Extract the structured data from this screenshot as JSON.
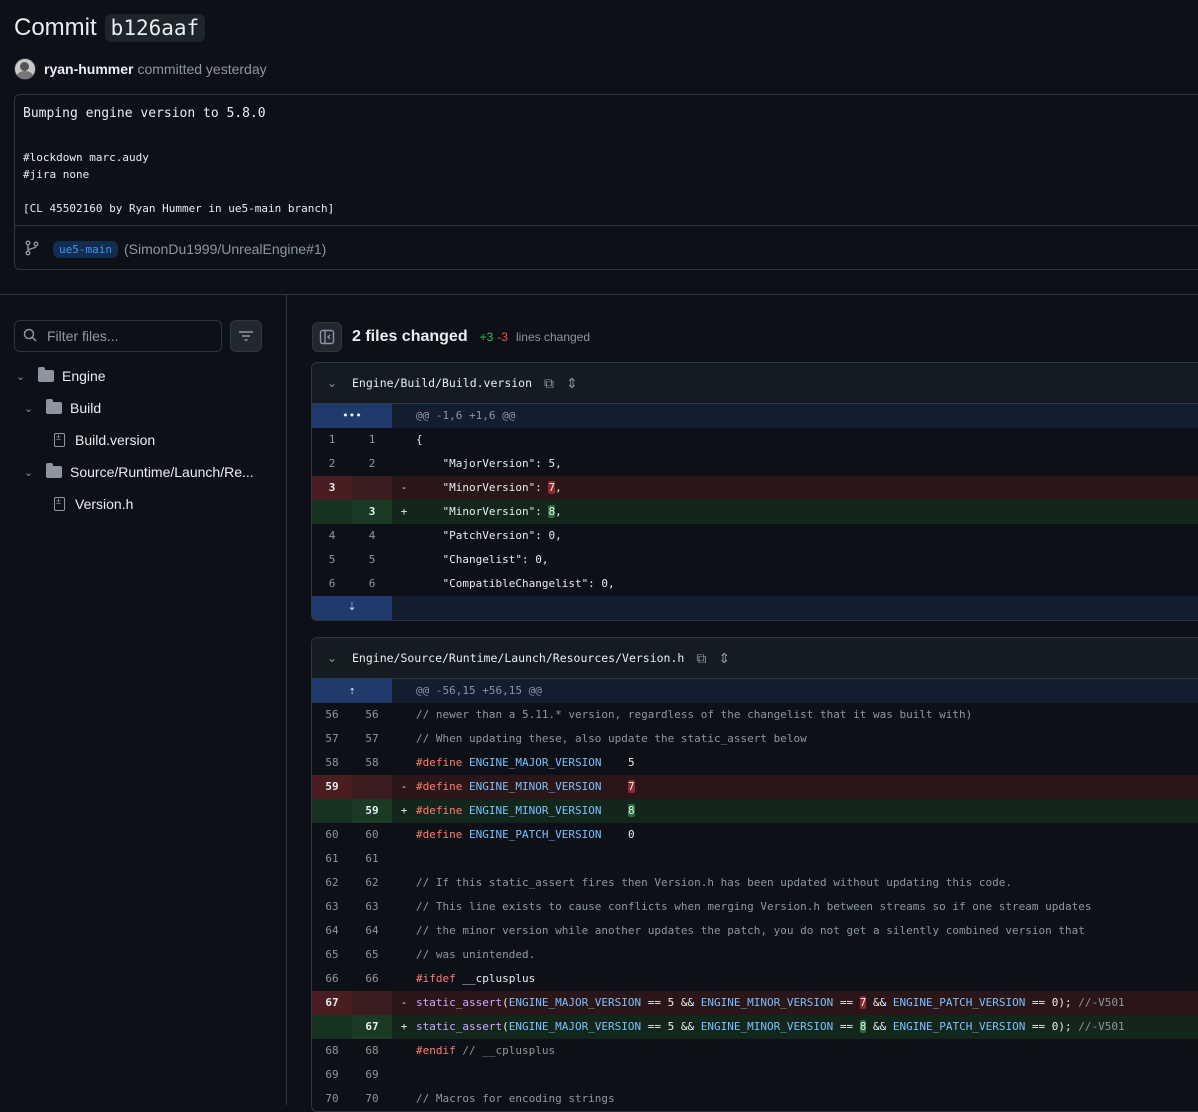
{
  "commit": {
    "title_prefix": "Commit",
    "sha": "b126aaf",
    "author": "ryan-hummer",
    "committed_text": "committed yesterday",
    "message_lines": [
      "Bumping engine version to 5.8.0",
      "",
      "#lockdown marc.audy",
      "#jira none",
      "",
      "[CL 45502160 by Ryan Hummer in ue5-main branch]"
    ],
    "branch": "ue5-main",
    "pr_ref": "(SimonDu1999/UnrealEngine#1)"
  },
  "sidebar": {
    "filter_placeholder": "Filter files...",
    "tree": [
      {
        "label": "Engine",
        "type": "folder",
        "depth": 0
      },
      {
        "label": "Build",
        "type": "folder",
        "depth": 1
      },
      {
        "label": "Build.version",
        "type": "file",
        "depth": 2
      },
      {
        "label": "Source/Runtime/Launch/Re...",
        "type": "folder",
        "depth": 1
      },
      {
        "label": "Version.h",
        "type": "file",
        "depth": 2
      }
    ]
  },
  "summary": {
    "files_changed": "2 files changed",
    "additions": "+3",
    "deletions": "-3",
    "lines_changed": "lines changed"
  },
  "files": [
    {
      "path": "Engine/Build/Build.version",
      "hunk": "@@ -1,6 +1,6 @@",
      "lines": [
        {
          "old": "1",
          "new": "1",
          "type": "ctx",
          "code": "{"
        },
        {
          "old": "2",
          "new": "2",
          "type": "ctx",
          "code": "    \"MajorVersion\": 5,"
        },
        {
          "old": "3",
          "new": "",
          "type": "del",
          "pre": "    \"MinorVersion\": ",
          "hl": "7",
          "post": ","
        },
        {
          "old": "",
          "new": "3",
          "type": "add",
          "pre": "    \"MinorVersion\": ",
          "hl": "8",
          "post": ","
        },
        {
          "old": "4",
          "new": "4",
          "type": "ctx",
          "code": "    \"PatchVersion\": 0,"
        },
        {
          "old": "5",
          "new": "5",
          "type": "ctx",
          "code": "    \"Changelist\": 0,"
        },
        {
          "old": "6",
          "new": "6",
          "type": "ctx",
          "code": "    \"CompatibleChangelist\": 0,"
        }
      ]
    },
    {
      "path": "Engine/Source/Runtime/Launch/Resources/Version.h",
      "hunk": "@@ -56,15 +56,15 @@",
      "lines": [
        {
          "old": "56",
          "new": "56",
          "type": "ctx",
          "code": "// newer than a 5.11.* version, regardless of the changelist that it was built with)",
          "style": "cm"
        },
        {
          "old": "57",
          "new": "57",
          "type": "ctx",
          "code": "// When updating these, also update the static_assert below",
          "style": "cm"
        },
        {
          "old": "58",
          "new": "58",
          "type": "ctx",
          "define": "ENGINE_MAJOR_VERSION",
          "val": "5"
        },
        {
          "old": "59",
          "new": "",
          "type": "del",
          "define": "ENGINE_MINOR_VERSION",
          "hl": "7"
        },
        {
          "old": "",
          "new": "59",
          "type": "add",
          "define": "ENGINE_MINOR_VERSION",
          "hl": "8"
        },
        {
          "old": "60",
          "new": "60",
          "type": "ctx",
          "define": "ENGINE_PATCH_VERSION",
          "val": "0"
        },
        {
          "old": "61",
          "new": "61",
          "type": "ctx",
          "code": ""
        },
        {
          "old": "62",
          "new": "62",
          "type": "ctx",
          "code": "// If this static_assert fires then Version.h has been updated without updating this code.",
          "style": "cm"
        },
        {
          "old": "63",
          "new": "63",
          "type": "ctx",
          "code": "// This line exists to cause conflicts when merging Version.h between streams so if one stream updates",
          "style": "cm"
        },
        {
          "old": "64",
          "new": "64",
          "type": "ctx",
          "code": "// the minor version while another updates the patch, you do not get a silently combined version that",
          "style": "cm"
        },
        {
          "old": "65",
          "new": "65",
          "type": "ctx",
          "code": "// was unintended.",
          "style": "cm"
        },
        {
          "old": "66",
          "new": "66",
          "type": "ctx",
          "ifdef": "#ifdef",
          "rest": " __cplusplus"
        },
        {
          "old": "67",
          "new": "",
          "type": "del",
          "assert": true,
          "hl": "7"
        },
        {
          "old": "",
          "new": "67",
          "type": "add",
          "assert": true,
          "hl": "8"
        },
        {
          "old": "68",
          "new": "68",
          "type": "ctx",
          "ifdef": "#endif",
          "rest": " // __cplusplus",
          "rest_style": "cm"
        },
        {
          "old": "69",
          "new": "69",
          "type": "ctx",
          "code": ""
        },
        {
          "old": "70",
          "new": "70",
          "type": "ctx",
          "code": "// Macros for encoding strings",
          "style": "cm"
        }
      ]
    }
  ],
  "assert_parts": {
    "fn": "static_assert",
    "a": "(",
    "m1": "ENGINE_MAJOR_VERSION",
    "b": " == 5 && ",
    "m2": "ENGINE_MINOR_VERSION",
    "c": " == ",
    "d": " && ",
    "m3": "ENGINE_PATCH_VERSION",
    "e": " == 0); ",
    "comment": "//-V501"
  },
  "define_keyword": "#define",
  "signs": {
    "del": "-",
    "add": "+"
  },
  "colors": {
    "added": "#3fb950",
    "deleted": "#f85149",
    "accent": "#4493f8"
  }
}
